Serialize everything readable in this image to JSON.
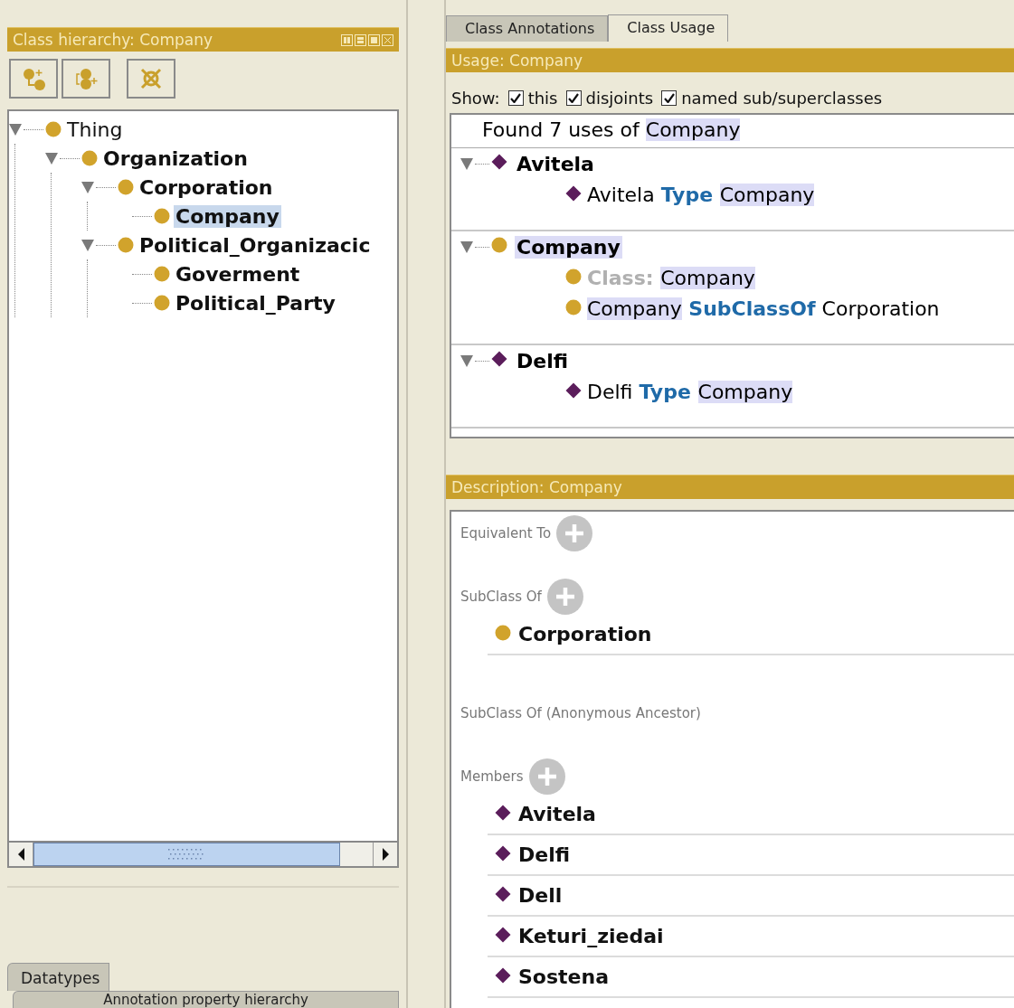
{
  "hierarchy_panel": {
    "title": "Class hierarchy: Company",
    "tree": [
      {
        "label": "Thing",
        "kind": "class",
        "expanded": true,
        "selected": false,
        "children": [
          {
            "label": "Organization",
            "kind": "class",
            "expanded": true,
            "selected": false,
            "children": [
              {
                "label": "Corporation",
                "kind": "class",
                "expanded": true,
                "selected": false,
                "children": [
                  {
                    "label": "Company",
                    "kind": "class",
                    "expanded": false,
                    "selected": true
                  }
                ]
              },
              {
                "label": "Political_Organizacic",
                "kind": "class",
                "expanded": true,
                "selected": false,
                "children": [
                  {
                    "label": "Goverment",
                    "kind": "class",
                    "expanded": false,
                    "selected": false
                  },
                  {
                    "label": "Political_Party",
                    "kind": "class",
                    "expanded": false,
                    "selected": false
                  }
                ]
              }
            ]
          }
        ]
      }
    ]
  },
  "bottom_tabs": [
    "Datatypes",
    "Annotation property hierarchy"
  ],
  "tabs": [
    {
      "label": "Class Annotations",
      "selected": false
    },
    {
      "label": "Class Usage",
      "selected": true
    }
  ],
  "usage_panel": {
    "title": "Usage: Company",
    "show_label": "Show:",
    "options": [
      {
        "label": "this",
        "checked": true
      },
      {
        "label": "disjoints",
        "checked": true
      },
      {
        "label": "named sub/superclasses",
        "checked": true
      }
    ],
    "summary": [
      {
        "text": "Found 7 uses of ",
        "highlighted": false
      },
      {
        "text": "Company",
        "highlighted": true
      }
    ],
    "groups": [
      {
        "label": "Avitela",
        "kind": "individual",
        "expanded": true,
        "highlighted": false,
        "lines": [
          {
            "kind": "individual",
            "parts": [
              {
                "text": "Avitela ",
                "kind": "plain",
                "highlighted": false
              },
              {
                "text": "Type ",
                "kind": "keyword",
                "highlighted": false
              },
              {
                "text": "Company",
                "kind": "plain",
                "highlighted": true
              }
            ]
          }
        ]
      },
      {
        "label": "Company",
        "kind": "class",
        "expanded": true,
        "highlighted": true,
        "lines": [
          {
            "kind": "class",
            "parts": [
              {
                "text": "Class: ",
                "kind": "muted",
                "highlighted": false
              },
              {
                "text": "Company",
                "kind": "plain",
                "highlighted": true
              }
            ]
          },
          {
            "kind": "class",
            "parts": [
              {
                "text": "Company",
                "kind": "plain",
                "highlighted": true
              },
              {
                "text": " SubClassOf",
                "kind": "keyword",
                "highlighted": false
              },
              {
                "text": " Corporation",
                "kind": "plain",
                "highlighted": false
              }
            ]
          }
        ]
      },
      {
        "label": "Delfi",
        "kind": "individual",
        "expanded": true,
        "highlighted": false,
        "lines": [
          {
            "kind": "individual",
            "parts": [
              {
                "text": "Delfi ",
                "kind": "plain",
                "highlighted": false
              },
              {
                "text": "Type ",
                "kind": "keyword",
                "highlighted": false
              },
              {
                "text": "Company",
                "kind": "plain",
                "highlighted": true
              }
            ]
          }
        ]
      }
    ]
  },
  "description_panel": {
    "title": "Description: Company",
    "sections": [
      {
        "label": "Equivalent To",
        "addable": true
      },
      {
        "label": "SubClass Of",
        "addable": true,
        "items": [
          {
            "label": "Corporation",
            "kind": "class"
          }
        ]
      },
      {
        "label": "SubClass Of (Anonymous Ancestor)",
        "addable": false
      },
      {
        "label": "Members",
        "addable": true,
        "items": [
          {
            "label": "Avitela",
            "kind": "individual"
          },
          {
            "label": "Delfi",
            "kind": "individual"
          },
          {
            "label": "Dell",
            "kind": "individual"
          },
          {
            "label": "Keturi_ziedai",
            "kind": "individual"
          },
          {
            "label": "Sostena",
            "kind": "individual"
          }
        ]
      }
    ]
  }
}
